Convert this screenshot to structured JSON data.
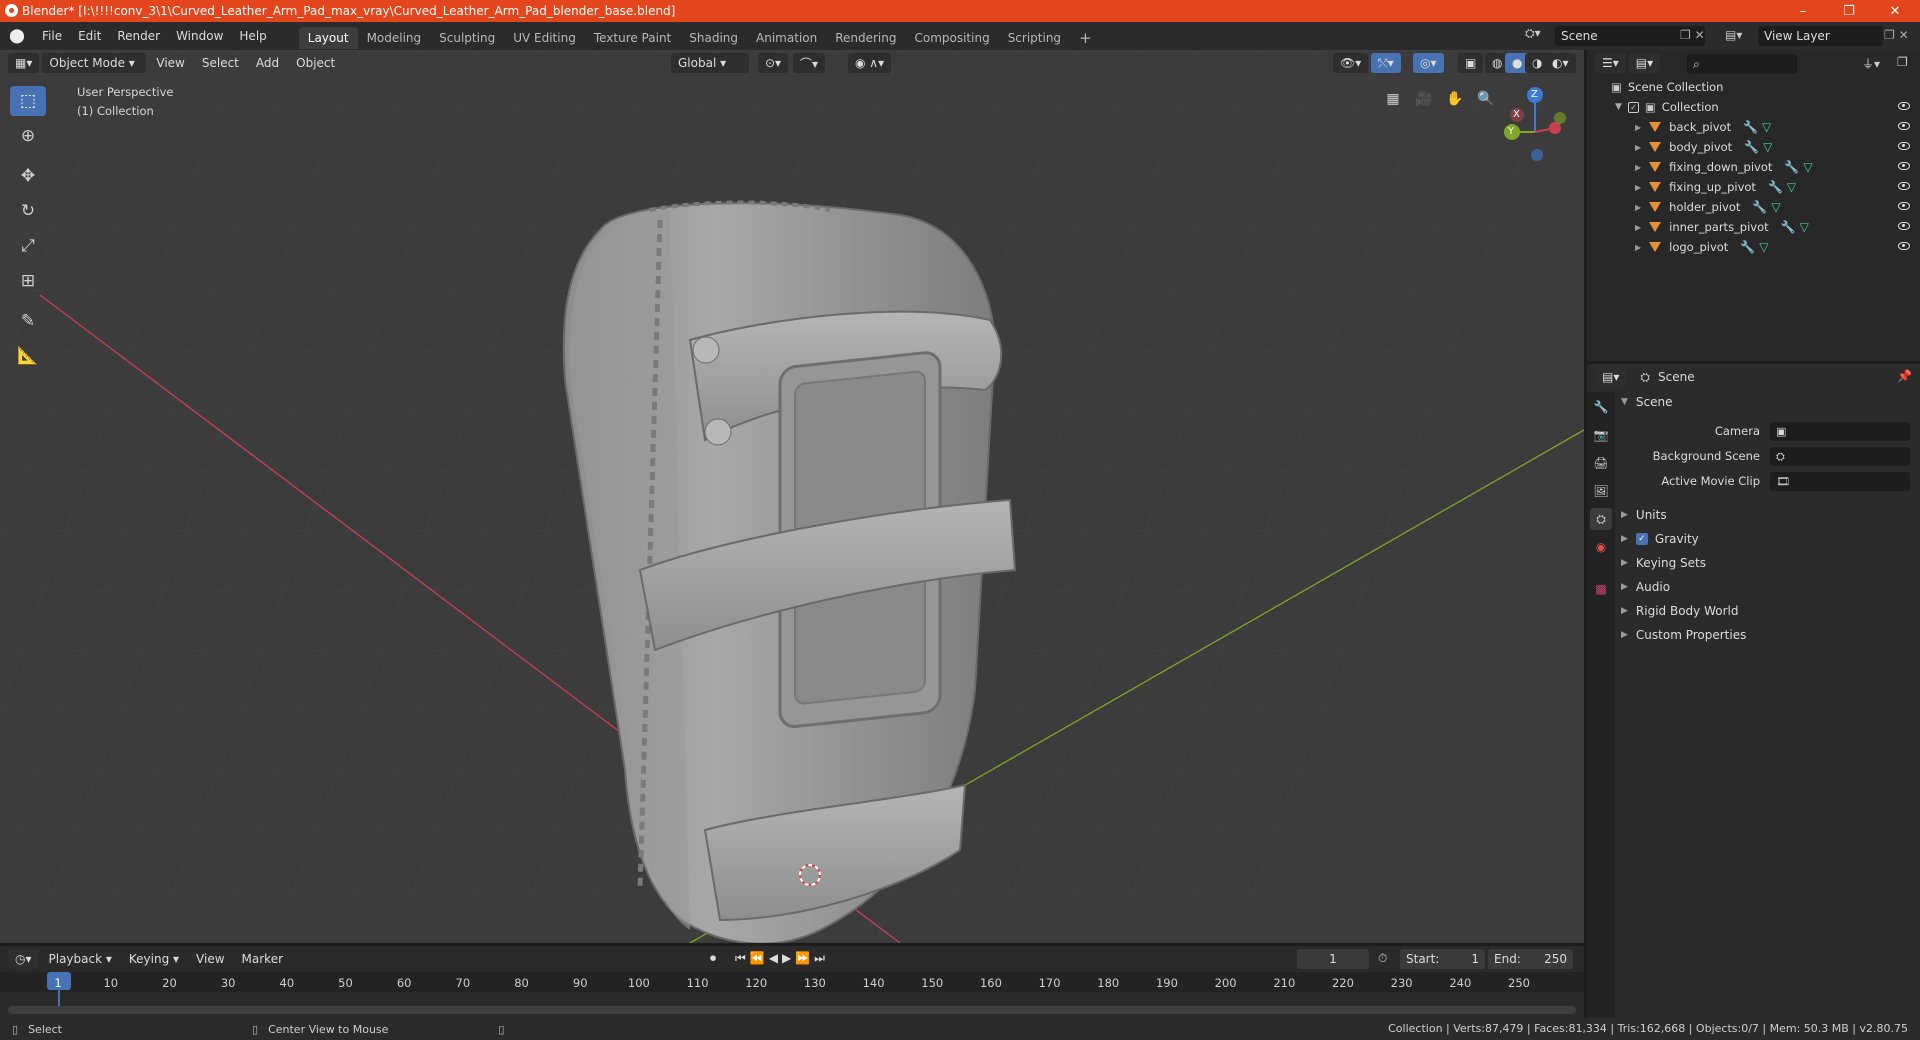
{
  "window": {
    "title": "Blender* [I:\\!!!!conv_3\\1\\Curved_Leather_Arm_Pad_max_vray\\Curved_Leather_Arm_Pad_blender_base.blend]",
    "minimize": "–",
    "restore": "❐",
    "close": "✕"
  },
  "menu": {
    "items": [
      "File",
      "Edit",
      "Render",
      "Window",
      "Help"
    ],
    "workspaces": [
      "Layout",
      "Modeling",
      "Sculpting",
      "UV Editing",
      "Texture Paint",
      "Shading",
      "Animation",
      "Rendering",
      "Compositing",
      "Scripting"
    ],
    "add_workspace": "+",
    "scene_name": "Scene",
    "view_layer": "View Layer"
  },
  "viewport": {
    "mode": "Object Mode",
    "header_menus": [
      "View",
      "Select",
      "Add",
      "Object"
    ],
    "orientation": "Global",
    "perspective_label": "User Perspective",
    "collection_label": "(1) Collection",
    "gizmo": {
      "x": "X",
      "y": "Y",
      "z": "Z"
    }
  },
  "outliner": {
    "root": "Scene Collection",
    "collection": "Collection",
    "objects": [
      "back_pivot",
      "body_pivot",
      "fixing_down_pivot",
      "fixing_up_pivot",
      "holder_pivot",
      "inner_parts_pivot",
      "logo_pivot"
    ]
  },
  "properties": {
    "header": "Scene",
    "section": "Scene",
    "fields": [
      {
        "label": "Camera",
        "value": ""
      },
      {
        "label": "Background Scene",
        "value": ""
      },
      {
        "label": "Active Movie Clip",
        "value": ""
      }
    ],
    "panels": [
      "Units",
      "Gravity",
      "Keying Sets",
      "Audio",
      "Rigid Body World",
      "Custom Properties"
    ],
    "gravity_checked": true
  },
  "timeline": {
    "menus": [
      "Playback",
      "Keying",
      "View",
      "Marker"
    ],
    "current_frame": "1",
    "start_label": "Start:",
    "start": "1",
    "end_label": "End:",
    "end": "250",
    "ticks": [
      "1",
      "10",
      "20",
      "30",
      "40",
      "50",
      "60",
      "70",
      "80",
      "90",
      "100",
      "110",
      "120",
      "130",
      "140",
      "150",
      "160",
      "170",
      "180",
      "190",
      "200",
      "210",
      "220",
      "230",
      "240",
      "250"
    ]
  },
  "status": {
    "left": "Select",
    "middle": "Center View to Mouse",
    "stats": "Collection | Verts:87,479 | Faces:81,334 | Tris:162,668 | Objects:0/7 | Mem: 50.3 MB | v2.80.75"
  },
  "colors": {
    "accent": "#4772b3",
    "titlebar": "#e3461c",
    "object_icon": "#e88f3c",
    "x_axis": "#c8414f",
    "y_axis": "#7fa628",
    "z_axis": "#3d7ad9"
  }
}
